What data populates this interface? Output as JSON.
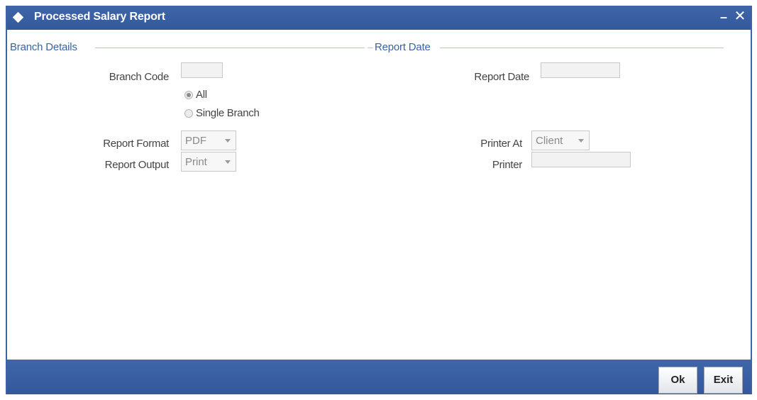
{
  "window": {
    "title": "Processed Salary Report"
  },
  "title_controls": {
    "minimize": "–",
    "close": "✕"
  },
  "sections": {
    "branch_details": "Branch Details",
    "report_date": "Report Date"
  },
  "branch": {
    "code_label": "Branch Code",
    "code_value": "",
    "options": [
      {
        "label": "All",
        "checked": true
      },
      {
        "label": "Single Branch",
        "checked": false
      }
    ]
  },
  "report_date": {
    "label": "Report Date",
    "value": ""
  },
  "report_format": {
    "label": "Report Format",
    "value": "PDF"
  },
  "report_output": {
    "label": "Report Output",
    "value": "Print"
  },
  "printer_at": {
    "label": "Printer At",
    "value": "Client"
  },
  "printer": {
    "label": "Printer",
    "value": ""
  },
  "buttons": {
    "ok": "Ok",
    "exit": "Exit"
  },
  "colors": {
    "accent": "#3f66a8",
    "section_text": "#3a63a3"
  }
}
